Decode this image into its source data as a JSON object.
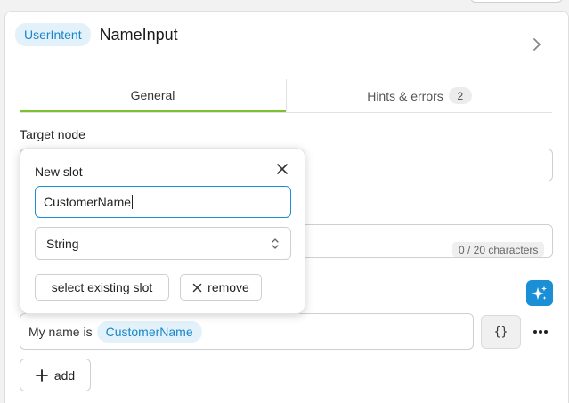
{
  "header": {
    "intent_type": "UserIntent",
    "intent_name": "NameInput"
  },
  "tabs": [
    {
      "label": "General",
      "active": true
    },
    {
      "label": "Hints & errors",
      "count": "2"
    }
  ],
  "target_node": {
    "label": "Target node",
    "value": ""
  },
  "message_field": {
    "char_count": "0 / 20 characters"
  },
  "utterance": {
    "text": "My name is",
    "slot": "CustomerName"
  },
  "braces_label": "{}",
  "add_label": "add",
  "popover": {
    "title": "New slot",
    "name_value": "CustomerName",
    "type_value": "String",
    "select_existing_label": "select existing slot",
    "remove_label": "remove"
  },
  "colors": {
    "accent": "#1a8fd6",
    "tab_active": "#7cc12f",
    "chip_bg": "#e3f1fa",
    "chip_text": "#1b86c6"
  }
}
